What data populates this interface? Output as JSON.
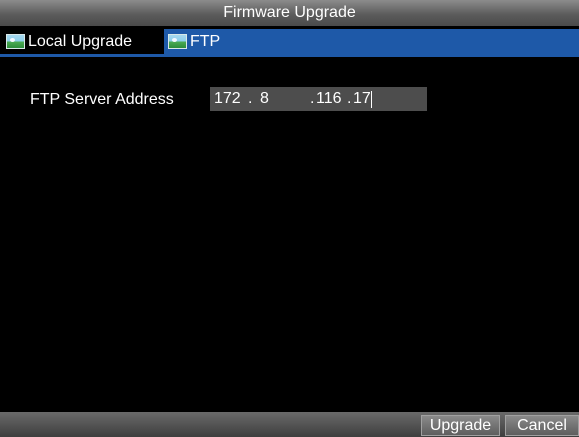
{
  "window": {
    "title": "Firmware Upgrade"
  },
  "tabs": [
    {
      "label": "Local Upgrade",
      "icon": "landscape-icon",
      "selected": false
    },
    {
      "label": "FTP",
      "icon": "landscape-icon",
      "selected": true
    }
  ],
  "form": {
    "ftp_server_label": "FTP Server Address",
    "ip": {
      "octet1": "172",
      "octet2": "8",
      "octet3": "116",
      "octet4": "17",
      "separator": "."
    }
  },
  "footer": {
    "upgrade_label": "Upgrade",
    "cancel_label": "Cancel"
  },
  "colors": {
    "accent": "#1e59a8",
    "background": "#000000",
    "input_bg": "#4d4d4d"
  }
}
